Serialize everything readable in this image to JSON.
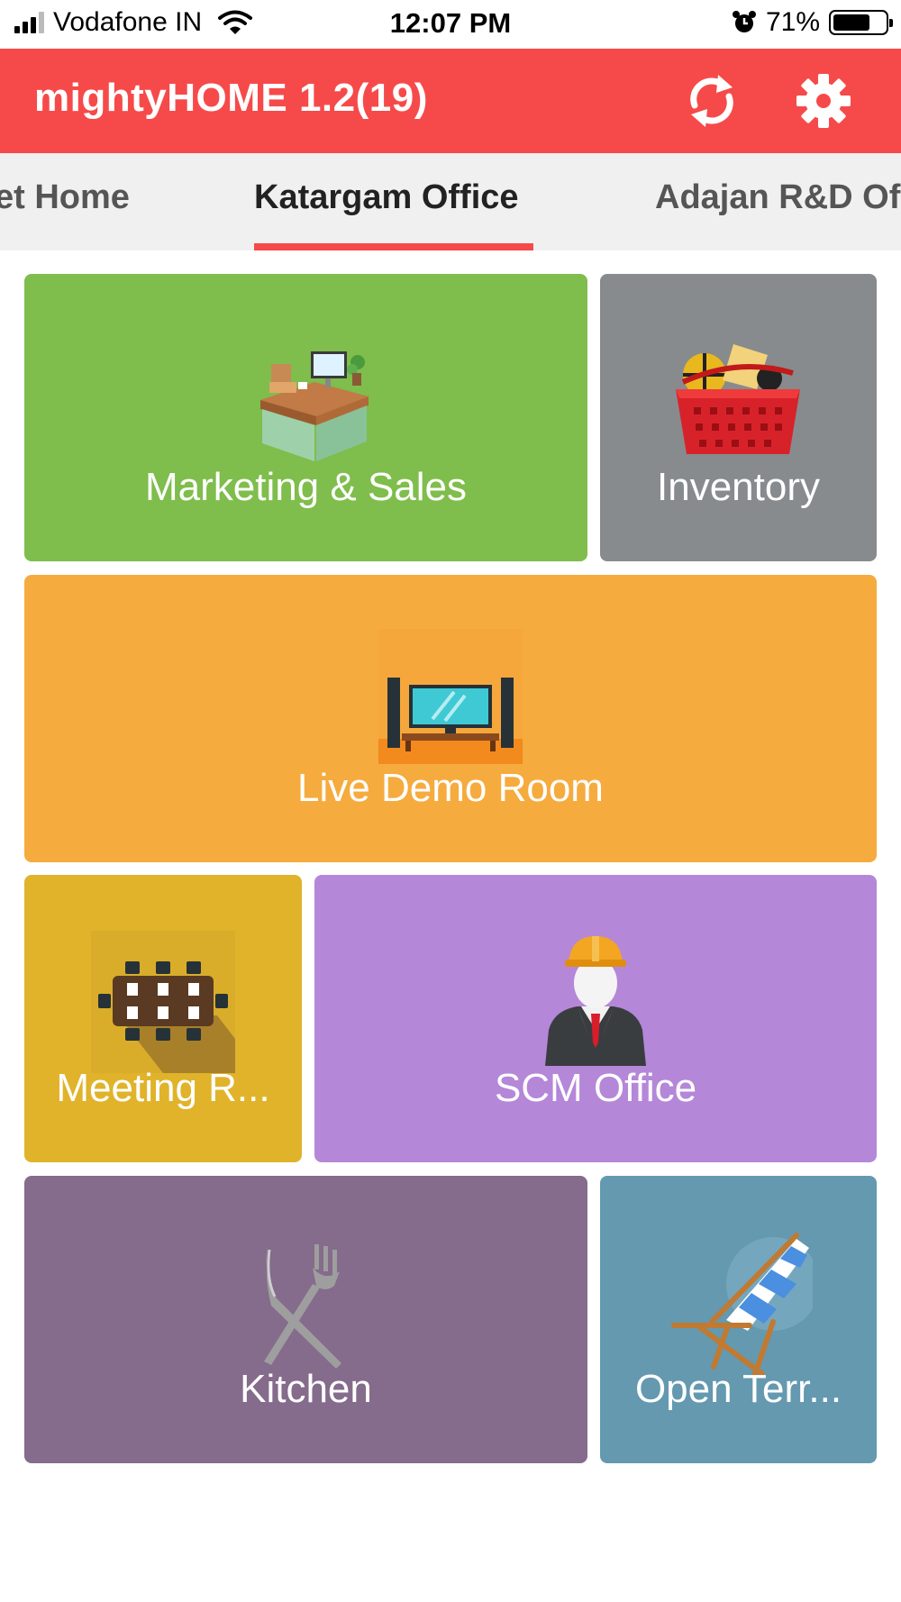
{
  "status_bar": {
    "carrier": "Vodafone IN",
    "time": "12:07 PM",
    "battery_text": "71%",
    "battery_level": 0.71
  },
  "app_bar": {
    "title": "mightyHOME 1.2(19)",
    "refresh_icon": "refresh-icon",
    "settings_icon": "gear-icon"
  },
  "tabs": [
    {
      "label": "et Home",
      "active": false
    },
    {
      "label": "Katargam Office",
      "active": true
    },
    {
      "label": "Adajan R&D Of",
      "active": false
    }
  ],
  "rooms": [
    {
      "label": "Marketing & Sales",
      "color": "#7fbd4c",
      "icon": "office-desk-icon"
    },
    {
      "label": "Inventory",
      "color": "#878b8d",
      "icon": "basket-icon"
    },
    {
      "label": "Live Demo Room",
      "color": "#f6ab3e",
      "icon": "home-theater-icon"
    },
    {
      "label": "Meeting R...",
      "color": "#e0b32b",
      "icon": "conference-table-icon"
    },
    {
      "label": "SCM Office",
      "color": "#b587d8",
      "icon": "engineer-icon"
    },
    {
      "label": "Kitchen",
      "color": "#856b8c",
      "icon": "cutlery-icon"
    },
    {
      "label": "Open Terr...",
      "color": "#6499b0",
      "icon": "deck-chair-icon"
    }
  ],
  "colors": {
    "accent": "#f64a4a",
    "tab_bar": "#f0f0f0"
  }
}
